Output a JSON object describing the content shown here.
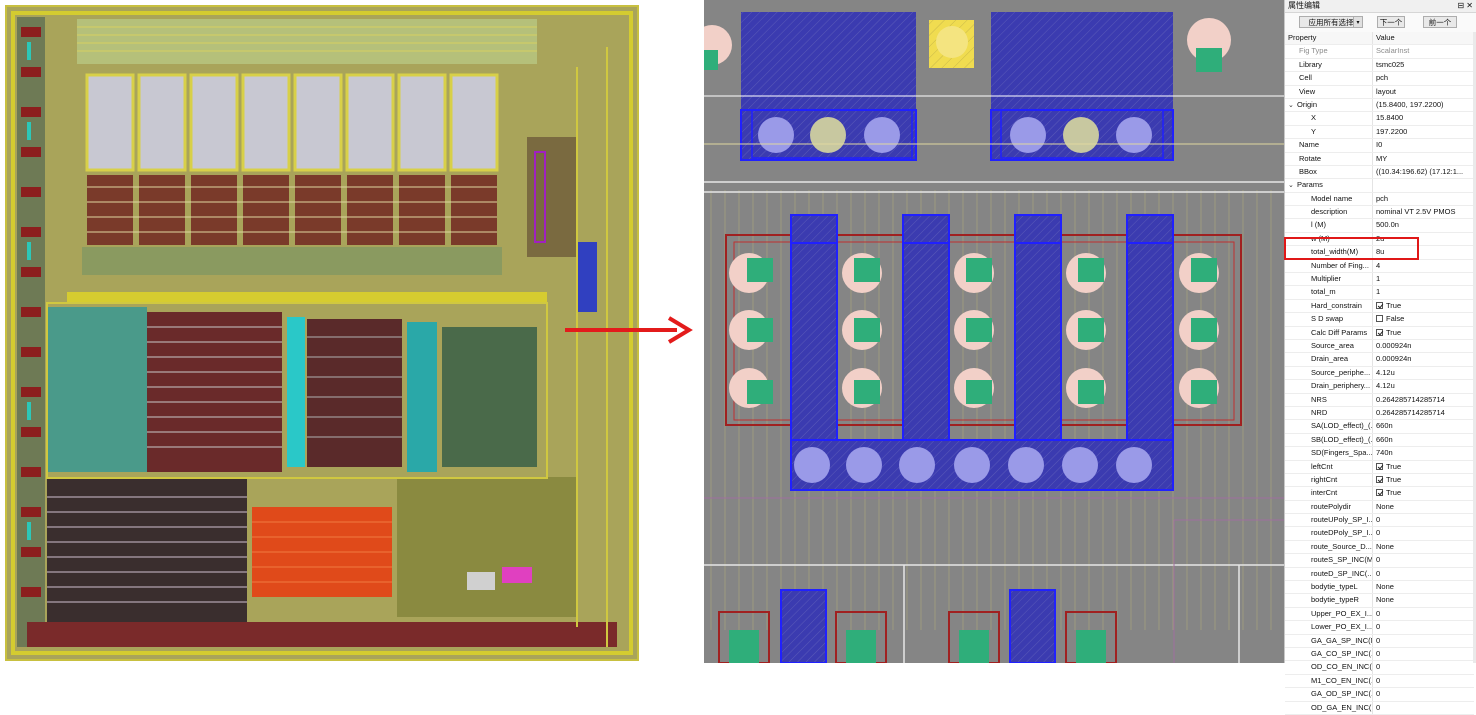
{
  "panel": {
    "title": "属性编辑",
    "controls": "⊟ ✕",
    "toolbar": {
      "apply_all": "应用所有选择",
      "dropdown": "▾",
      "next": "下一个",
      "prev": "前一个"
    },
    "header": {
      "property": "Property",
      "value": "Value"
    },
    "rows": [
      {
        "prop": "Fig Type",
        "val": "ScalarInst",
        "level": 1,
        "dim": true
      },
      {
        "prop": "Library",
        "val": "tsmc025",
        "level": 1
      },
      {
        "prop": "Cell",
        "val": "pch",
        "level": 1
      },
      {
        "prop": "View",
        "val": "layout",
        "level": 1
      },
      {
        "prop": "Origin",
        "val": "(15.8400, 197.2200)",
        "level": 0,
        "expander": "⌄"
      },
      {
        "prop": "X",
        "val": "15.8400",
        "level": 2
      },
      {
        "prop": "Y",
        "val": "197.2200",
        "level": 2
      },
      {
        "prop": "Name",
        "val": "I0",
        "level": 1
      },
      {
        "prop": "Rotate",
        "val": "MY",
        "level": 1
      },
      {
        "prop": "BBox",
        "val": "((10.34:196.62) (17.12:1...",
        "level": 1
      },
      {
        "prop": "Params",
        "val": "",
        "level": 0,
        "expander": "⌄"
      },
      {
        "prop": "Model name",
        "val": "pch",
        "level": 2
      },
      {
        "prop": "description",
        "val": "nominal VT 2.5V PMOS",
        "level": 2
      },
      {
        "prop": "l (M)",
        "val": "500.0n",
        "level": 2
      },
      {
        "prop": "w (M)",
        "val": "2u",
        "level": 2
      },
      {
        "prop": "total_width(M)",
        "val": "8u",
        "level": 2
      },
      {
        "prop": "Number of Fing...",
        "val": "4",
        "level": 2
      },
      {
        "prop": "Multiplier",
        "val": "1",
        "level": 2
      },
      {
        "prop": "total_m",
        "val": "1",
        "level": 2
      },
      {
        "prop": "Hard_constrain",
        "val": "True",
        "level": 2,
        "check": true
      },
      {
        "prop": "S D swap",
        "val": "False",
        "level": 2,
        "check": false
      },
      {
        "prop": "Calc Diff Params",
        "val": "True",
        "level": 2,
        "check": true
      },
      {
        "prop": "Source_area",
        "val": "0.000924n",
        "level": 2
      },
      {
        "prop": "Drain_area",
        "val": "0.000924n",
        "level": 2
      },
      {
        "prop": "Source_periphe...",
        "val": "4.12u",
        "level": 2
      },
      {
        "prop": "Drain_periphery...",
        "val": "4.12u",
        "level": 2
      },
      {
        "prop": "NRS",
        "val": "0.264285714285714",
        "level": 2
      },
      {
        "prop": "NRD",
        "val": "0.264285714285714",
        "level": 2
      },
      {
        "prop": "SA(LOD_effect)_(...",
        "val": "660n",
        "level": 2
      },
      {
        "prop": "SB(LOD_effect)_(...",
        "val": "660n",
        "level": 2
      },
      {
        "prop": "SD(Fingers_Spa...",
        "val": "740n",
        "level": 2
      },
      {
        "prop": "leftCnt",
        "val": "True",
        "level": 2,
        "check": true
      },
      {
        "prop": "rightCnt",
        "val": "True",
        "level": 2,
        "check": true
      },
      {
        "prop": "interCnt",
        "val": "True",
        "level": 2,
        "check": true
      },
      {
        "prop": "routePolydir",
        "val": "None",
        "level": 2
      },
      {
        "prop": "routeUPoly_SP_I...",
        "val": "0",
        "level": 2
      },
      {
        "prop": "routeDPoly_SP_I...",
        "val": "0",
        "level": 2
      },
      {
        "prop": "route_Source_D...",
        "val": "None",
        "level": 2
      },
      {
        "prop": "routeS_SP_INC(M)",
        "val": "0",
        "level": 2
      },
      {
        "prop": "routeD_SP_INC(...",
        "val": "0",
        "level": 2
      },
      {
        "prop": "bodytie_typeL",
        "val": "None",
        "level": 2
      },
      {
        "prop": "bodytie_typeR",
        "val": "None",
        "level": 2
      },
      {
        "prop": "Upper_PO_EX_I...",
        "val": "0",
        "level": 2
      },
      {
        "prop": "Lower_PO_EX_I...",
        "val": "0",
        "level": 2
      },
      {
        "prop": "GA_GA_SP_INC(M)",
        "val": "0",
        "level": 2
      },
      {
        "prop": "GA_CO_SP_INC(...",
        "val": "0",
        "level": 2
      },
      {
        "prop": "OD_CO_EN_INC(...",
        "val": "0",
        "level": 2
      },
      {
        "prop": "M1_CO_EN_INC(...",
        "val": "0",
        "level": 2
      },
      {
        "prop": "GA_OD_SP_INC(...",
        "val": "0",
        "level": 2
      },
      {
        "prop": "OD_GA_EN_INC(...",
        "val": "0",
        "level": 2
      }
    ]
  },
  "colors": {
    "highlight": "#e01818",
    "arrow": "#e31b1b",
    "metal1_blue": "#1a1ae6",
    "diffusion_green": "#2fae7a",
    "poly_red": "#b02020"
  }
}
